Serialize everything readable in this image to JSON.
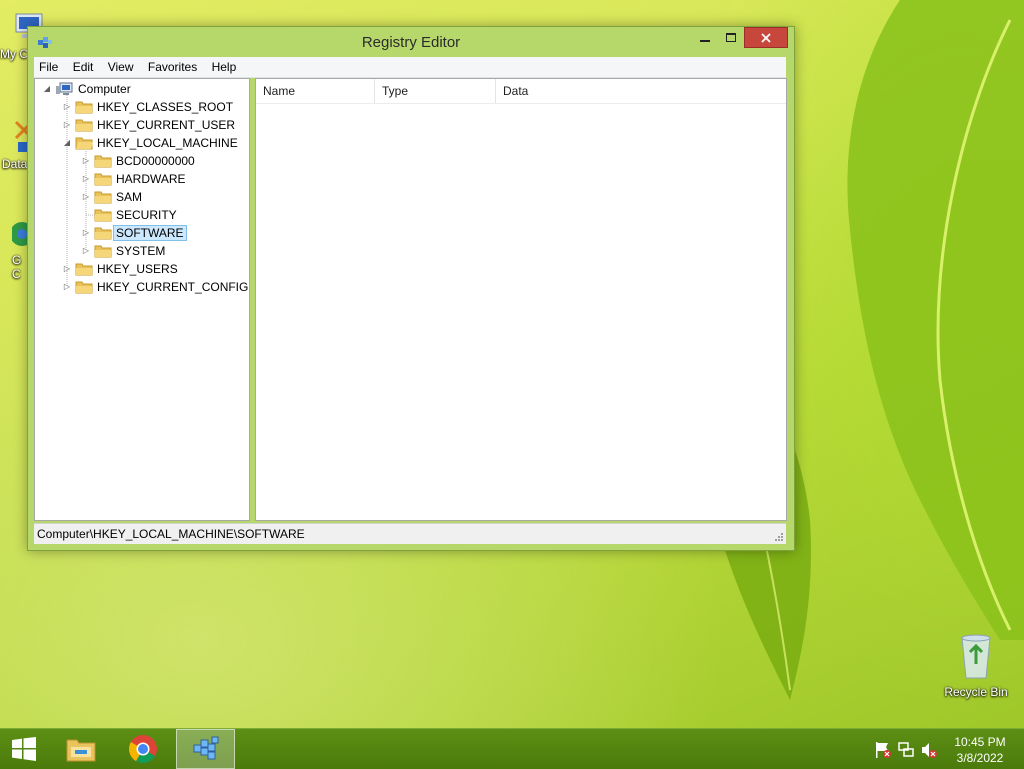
{
  "window": {
    "title": "Registry Editor",
    "menu": [
      "File",
      "Edit",
      "View",
      "Favorites",
      "Help"
    ],
    "tree": {
      "root": "Computer",
      "hives": [
        "HKEY_CLASSES_ROOT",
        "HKEY_CURRENT_USER",
        "HKEY_LOCAL_MACHINE",
        "HKEY_USERS",
        "HKEY_CURRENT_CONFIG"
      ],
      "hklm_children": [
        "BCD00000000",
        "HARDWARE",
        "SAM",
        "SECURITY",
        "SOFTWARE",
        "SYSTEM"
      ],
      "selected": "SOFTWARE"
    },
    "columns": [
      "Name",
      "Type",
      "Data"
    ],
    "status": "Computer\\HKEY_LOCAL_MACHINE\\SOFTWARE"
  },
  "desktop": {
    "icons": {
      "my_computer_partial": "My C",
      "data_partial": "Data",
      "chrome_partial_1": "G",
      "chrome_partial_2": "C",
      "recycle_bin": "Recycle Bin"
    }
  },
  "taskbar": {
    "items": [
      "start-icon",
      "file-explorer-icon",
      "chrome-icon",
      "registry-editor-icon"
    ],
    "tray_icons": [
      "action-center-flag-icon",
      "network-icon",
      "volume-muted-icon"
    ],
    "time": "10:45 PM",
    "date": "3/8/2022"
  },
  "colors": {
    "taskbar": "#4f7f0f",
    "window_frame": "#b6d86a",
    "close_button": "#c7473c",
    "selection": "#cce8ff"
  }
}
